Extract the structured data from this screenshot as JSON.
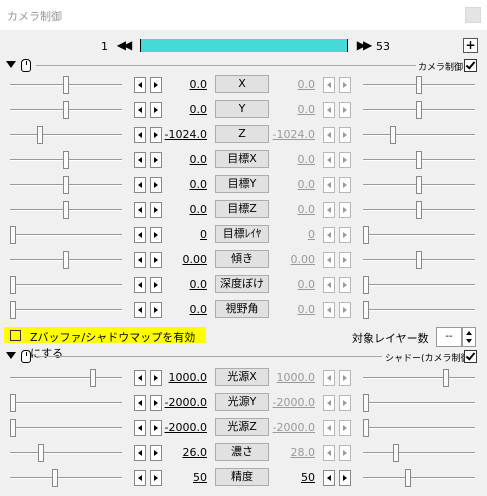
{
  "window": {
    "title": "カメラ制御"
  },
  "timeline": {
    "start_frame": "1",
    "end_frame": "53",
    "prev_icon": "double-left-icon",
    "next_icon": "double-right-icon",
    "add_label": "+"
  },
  "camera_section": {
    "label": "カメラ制御",
    "checked": true,
    "rows": [
      {
        "name": "x",
        "label": "X",
        "value": "0.0",
        "end_value": "0.0",
        "thumb_left": 0.5,
        "thumb_right": 0.5,
        "end_enabled": false
      },
      {
        "name": "y",
        "label": "Y",
        "value": "0.0",
        "end_value": "0.0",
        "thumb_left": 0.5,
        "thumb_right": 0.5,
        "end_enabled": false
      },
      {
        "name": "z",
        "label": "Z",
        "value": "-1024.0",
        "end_value": "-1024.0",
        "thumb_left": 0.25,
        "thumb_right": 0.25,
        "end_enabled": false
      },
      {
        "name": "target-x",
        "label": "目標X",
        "value": "0.0",
        "end_value": "0.0",
        "thumb_left": 0.5,
        "thumb_right": 0.5,
        "end_enabled": false
      },
      {
        "name": "target-y",
        "label": "目標Y",
        "value": "0.0",
        "end_value": "0.0",
        "thumb_left": 0.5,
        "thumb_right": 0.5,
        "end_enabled": false
      },
      {
        "name": "target-z",
        "label": "目標Z",
        "value": "0.0",
        "end_value": "0.0",
        "thumb_left": 0.5,
        "thumb_right": 0.5,
        "end_enabled": false
      },
      {
        "name": "target-layer",
        "label": "目標ﾚｲﾔ",
        "value": "0",
        "end_value": "0",
        "thumb_left": 0.0,
        "thumb_right": 0.0,
        "end_enabled": false
      },
      {
        "name": "tilt",
        "label": "傾き",
        "value": "0.00",
        "end_value": "0.00",
        "thumb_left": 0.5,
        "thumb_right": 0.5,
        "end_enabled": false
      },
      {
        "name": "depth-blur",
        "label": "深度ぼけ",
        "value": "0.0",
        "end_value": "0.0",
        "thumb_left": 0.0,
        "thumb_right": 0.0,
        "end_enabled": false
      },
      {
        "name": "fov",
        "label": "視野角",
        "value": "0.0",
        "end_value": "0.0",
        "thumb_left": 0.0,
        "thumb_right": 0.0,
        "end_enabled": false
      }
    ]
  },
  "zbuffer": {
    "label": "Zバッファ/シャドウマップを有効にする",
    "checked": false
  },
  "target_layer_count": {
    "label": "対象レイヤー数",
    "value": "--"
  },
  "shadow_section": {
    "label": "シャドー(カメラ制御)",
    "checked": true,
    "rows": [
      {
        "name": "light-x",
        "label": "光源X",
        "value": "1000.0",
        "end_value": "1000.0",
        "thumb_left": 0.75,
        "thumb_right": 0.75,
        "end_enabled": false
      },
      {
        "name": "light-y",
        "label": "光源Y",
        "value": "-2000.0",
        "end_value": "-2000.0",
        "thumb_left": 0.0,
        "thumb_right": 0.0,
        "end_enabled": false
      },
      {
        "name": "light-z",
        "label": "光源Z",
        "value": "-2000.0",
        "end_value": "-2000.0",
        "thumb_left": 0.0,
        "thumb_right": 0.0,
        "end_enabled": false
      },
      {
        "name": "density",
        "label": "濃さ",
        "value": "26.0",
        "end_value": "28.0",
        "thumb_left": 0.26,
        "thumb_right": 0.28,
        "end_enabled": false
      },
      {
        "name": "precision",
        "label": "精度",
        "value": "50",
        "end_value": "50",
        "thumb_left": 0.4,
        "thumb_right": 0.4,
        "end_enabled": true
      }
    ]
  },
  "colors": {
    "timeline": "#45d9d8",
    "highlight": "#ffff00",
    "disabled_text": "#9a9a9a"
  }
}
